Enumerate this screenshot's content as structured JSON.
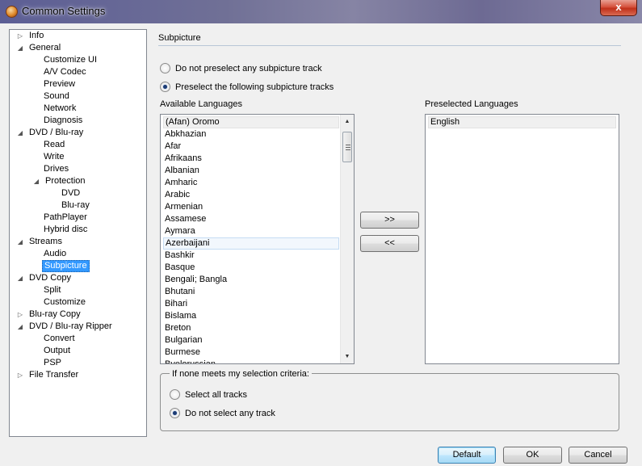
{
  "window": {
    "title": "Common Settings",
    "close_label": "x"
  },
  "tree": {
    "items": [
      {
        "label": "Info",
        "expander": "collapsed"
      },
      {
        "label": "General",
        "expander": "expanded"
      },
      {
        "label": "Customize UI",
        "expander": "none"
      },
      {
        "label": "A/V Codec",
        "expander": "none"
      },
      {
        "label": "Preview",
        "expander": "none"
      },
      {
        "label": "Sound",
        "expander": "none"
      },
      {
        "label": "Network",
        "expander": "none"
      },
      {
        "label": "Diagnosis",
        "expander": "none"
      },
      {
        "label": "DVD / Blu-ray",
        "expander": "expanded"
      },
      {
        "label": "Read",
        "expander": "none"
      },
      {
        "label": "Write",
        "expander": "none"
      },
      {
        "label": "Drives",
        "expander": "none"
      },
      {
        "label": "Protection",
        "expander": "expanded"
      },
      {
        "label": "DVD",
        "expander": "none"
      },
      {
        "label": "Blu-ray",
        "expander": "none"
      },
      {
        "label": "PathPlayer",
        "expander": "none"
      },
      {
        "label": "Hybrid disc",
        "expander": "none"
      },
      {
        "label": "Streams",
        "expander": "expanded"
      },
      {
        "label": "Audio",
        "expander": "none"
      },
      {
        "label": "Subpicture",
        "expander": "none",
        "selected": true
      },
      {
        "label": "DVD Copy",
        "expander": "expanded"
      },
      {
        "label": "Split",
        "expander": "none"
      },
      {
        "label": "Customize",
        "expander": "none"
      },
      {
        "label": "Blu-ray Copy",
        "expander": "collapsed"
      },
      {
        "label": "DVD / Blu-ray Ripper",
        "expander": "expanded"
      },
      {
        "label": "Convert",
        "expander": "none"
      },
      {
        "label": "Output",
        "expander": "none"
      },
      {
        "label": "PSP",
        "expander": "none"
      },
      {
        "label": "File Transfer",
        "expander": "collapsed"
      }
    ]
  },
  "section": {
    "title": "Subpicture",
    "preselect_options": [
      {
        "label": "Do not preselect any subpicture track",
        "checked": false
      },
      {
        "label": "Preselect the following subpicture tracks",
        "checked": true
      }
    ],
    "available_label": "Available Languages",
    "preselected_label": "Preselected Languages",
    "available_languages": [
      "(Afan) Oromo",
      "Abkhazian",
      "Afar",
      "Afrikaans",
      "Albanian",
      "Amharic",
      "Arabic",
      "Armenian",
      "Assamese",
      "Aymara",
      "Azerbaijani",
      "Bashkir",
      "Basque",
      "Bengali; Bangla",
      "Bhutani",
      "Bihari",
      "Bislama",
      "Breton",
      "Bulgarian",
      "Burmese",
      "Byelorussian"
    ],
    "preselected_languages": [
      "English"
    ],
    "add_button": ">>",
    "remove_button": "<<",
    "fallback": {
      "legend": "If none meets my selection criteria:",
      "options": [
        {
          "label": "Select all tracks",
          "checked": false
        },
        {
          "label": "Do not select any track",
          "checked": true
        }
      ]
    }
  },
  "footer": {
    "default_label": "Default",
    "ok_label": "OK",
    "cancel_label": "Cancel"
  },
  "icons": {
    "expander_collapsed": "▷",
    "expander_expanded": "◢",
    "scroll_up": "▲",
    "scroll_down": "▼"
  }
}
